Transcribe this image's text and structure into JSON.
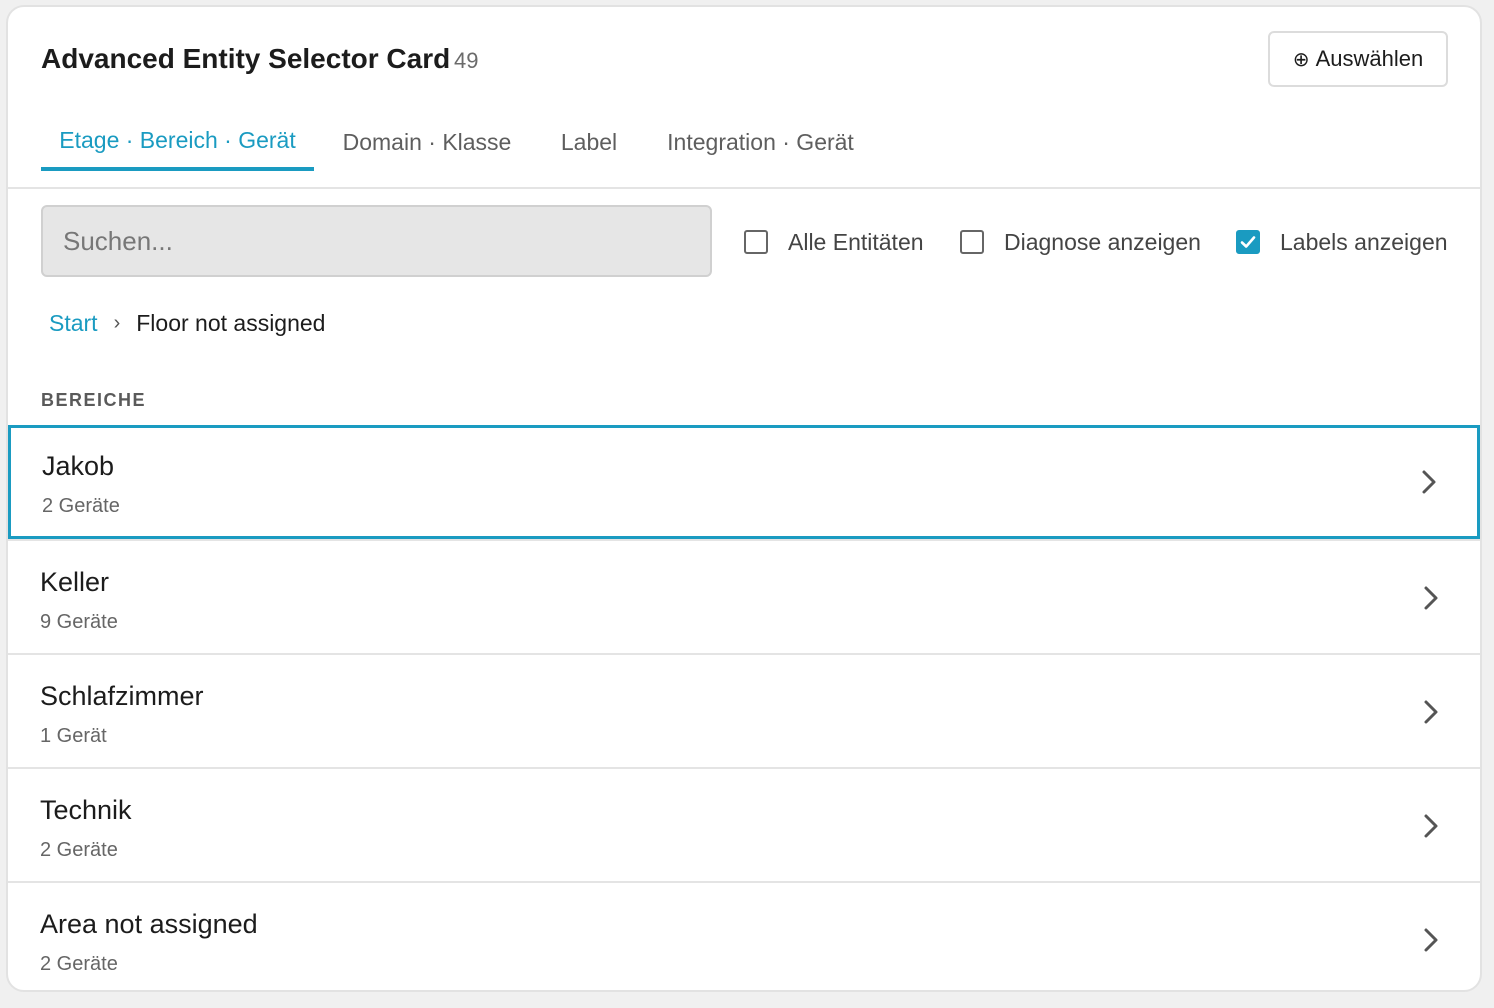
{
  "card": {
    "title": "Advanced Entity Selector Card",
    "count": "49",
    "select_button": {
      "icon": "⊕",
      "label": "Auswählen"
    }
  },
  "tabs": [
    {
      "label": "Etage · Bereich · Gerät",
      "active": true
    },
    {
      "label": "Domain · Klasse",
      "active": false
    },
    {
      "label": "Label",
      "active": false
    },
    {
      "label": "Integration · Gerät",
      "active": false
    }
  ],
  "search": {
    "placeholder": "Suchen...",
    "value": ""
  },
  "filters": [
    {
      "label": "Alle Entitäten",
      "checked": false
    },
    {
      "label": "Diagnose anzeigen",
      "checked": false
    },
    {
      "label": "Labels anzeigen",
      "checked": true
    }
  ],
  "breadcrumb": {
    "start": "Start",
    "separator": "›",
    "current": "Floor not assigned"
  },
  "section": {
    "label": "BEREICHE"
  },
  "areas": [
    {
      "name": "Jakob",
      "devices": "2 Geräte"
    },
    {
      "name": "Keller",
      "devices": "9 Geräte"
    },
    {
      "name": "Schlafzimmer",
      "devices": "1 Gerät"
    },
    {
      "name": "Technik",
      "devices": "2 Geräte"
    },
    {
      "name": "Area not assigned",
      "devices": "2 Geräte"
    }
  ],
  "colors": {
    "accent": "#1a9bc1",
    "divider": "#e4e4e4",
    "search_bg": "#e6e6e6"
  }
}
